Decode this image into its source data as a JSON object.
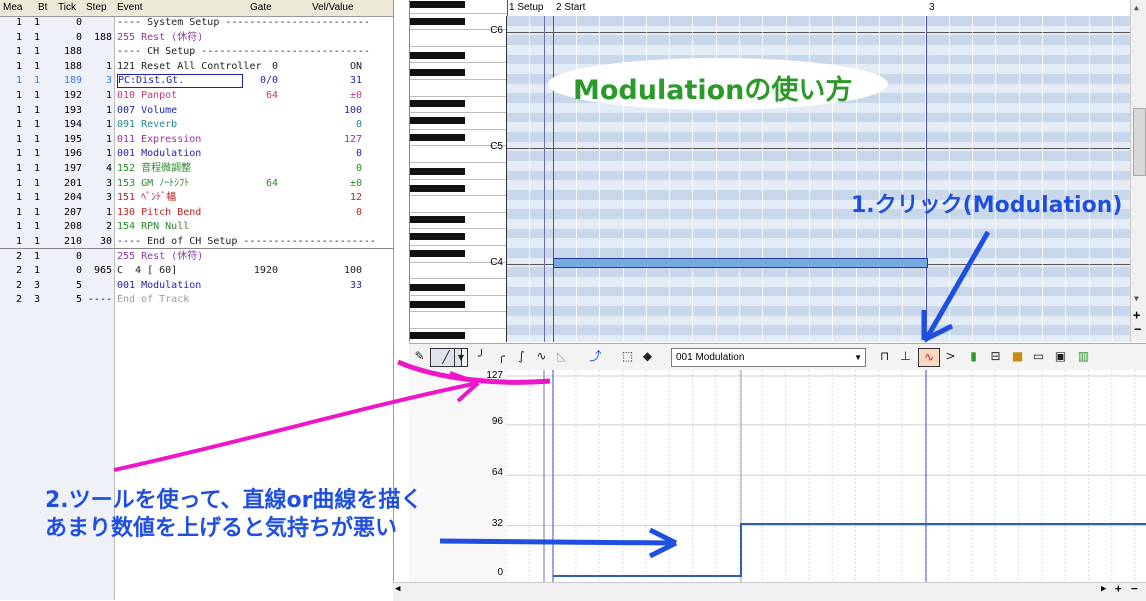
{
  "event_list": {
    "headers": {
      "mea": "Mea",
      "bt": "Bt",
      "tick": "Tick",
      "step": "Step",
      "event": "Event",
      "gate": "Gate",
      "vel": "Vel/Value"
    },
    "rows": [
      {
        "mea": "1",
        "bt": "1",
        "tick": "0",
        "step": "",
        "event": "---- System Setup ------------------------",
        "gate": "",
        "vel": "",
        "color": "#202020"
      },
      {
        "mea": "1",
        "bt": "1",
        "tick": "0",
        "step": "188",
        "event": "255 Rest (休符)",
        "gate": "",
        "vel": "",
        "color": "#8a3aa8"
      },
      {
        "mea": "1",
        "bt": "1",
        "tick": "188",
        "step": "",
        "event": "---- CH Setup ----------------------------",
        "gate": "",
        "vel": "",
        "color": "#202020"
      },
      {
        "mea": "1",
        "bt": "1",
        "tick": "188",
        "step": "1",
        "event": "121 Reset All Controller",
        "gate": "0",
        "vel": "ON",
        "color": "#202020"
      },
      {
        "mea": "1",
        "bt": "1",
        "tick": "189",
        "step": "3",
        "event": "PC:Dist.Gt.",
        "gate": "0/0",
        "vel": "31",
        "color": "#1f1fb0"
      },
      {
        "mea": "1",
        "bt": "1",
        "tick": "192",
        "step": "1",
        "event": "010 Panpot",
        "gate": "64",
        "vel": "±0",
        "color": "#c03a7a"
      },
      {
        "mea": "1",
        "bt": "1",
        "tick": "193",
        "step": "1",
        "event": "007 Volume",
        "gate": "",
        "vel": "100",
        "color": "#1f1fb0"
      },
      {
        "mea": "1",
        "bt": "1",
        "tick": "194",
        "step": "1",
        "event": "091 Reverb",
        "gate": "",
        "vel": "0",
        "color": "#1a8a8a"
      },
      {
        "mea": "1",
        "bt": "1",
        "tick": "195",
        "step": "1",
        "event": "011 Expression",
        "gate": "",
        "vel": "127",
        "color": "#a0309a"
      },
      {
        "mea": "1",
        "bt": "1",
        "tick": "196",
        "step": "1",
        "event": "001 Modulation",
        "gate": "",
        "vel": "0",
        "color": "#1f1fb0"
      },
      {
        "mea": "1",
        "bt": "1",
        "tick": "197",
        "step": "4",
        "event": "152 音程微調整",
        "gate": "",
        "vel": "0",
        "color": "#2a8a2a"
      },
      {
        "mea": "1",
        "bt": "1",
        "tick": "201",
        "step": "3",
        "event": "153 GM ﾉｰﾄｼﾌﾄ",
        "gate": "64",
        "vel": "±0",
        "color": "#2a8a2a"
      },
      {
        "mea": "1",
        "bt": "1",
        "tick": "204",
        "step": "3",
        "event": "151 ﾍﾞﾝﾄﾞ幅",
        "gate": "",
        "vel": "12",
        "color": "#c02020"
      },
      {
        "mea": "1",
        "bt": "1",
        "tick": "207",
        "step": "1",
        "event": "130 Pitch Bend",
        "gate": "",
        "vel": "0",
        "color": "#c02020"
      },
      {
        "mea": "1",
        "bt": "1",
        "tick": "208",
        "step": "2",
        "event": "154 RPN Null",
        "gate": "",
        "vel": "",
        "color": "#2a8a2a"
      },
      {
        "mea": "1",
        "bt": "1",
        "tick": "210",
        "step": "30",
        "event": "---- End of CH Setup ----------------------",
        "gate": "",
        "vel": "",
        "color": "#202020"
      },
      {
        "mea": "2",
        "bt": "1",
        "tick": "0",
        "step": "",
        "event": "255 Rest (休符)",
        "gate": "",
        "vel": "",
        "color": "#8a3aa8"
      },
      {
        "mea": "2",
        "bt": "1",
        "tick": "0",
        "step": "965",
        "event": "C  4 [ 60]",
        "gate": "1920",
        "vel": "100",
        "color": "#202020"
      },
      {
        "mea": "2",
        "bt": "3",
        "tick": "5",
        "step": "",
        "event": "001 Modulation",
        "gate": "",
        "vel": "33",
        "color": "#1f1fb0"
      },
      {
        "mea": "2",
        "bt": "3",
        "tick": "5",
        "step": "----",
        "event": "End of Track",
        "gate": "",
        "vel": "",
        "color": "#9a9a9a"
      }
    ]
  },
  "piano_roll": {
    "octave_labels": [
      "C6",
      "C5",
      "C4"
    ],
    "ruler_marks": [
      "1 Setup",
      "2 Start",
      "3"
    ]
  },
  "toolbar": {
    "controller_select": "001 Modulation",
    "icons": [
      "pencil-icon",
      "line-tool-icon",
      "dropdown-arrow-icon",
      "curve1-icon",
      "curve2-icon",
      "curve3-icon",
      "wave-icon",
      "gradient-icon",
      "connect-icon",
      "select-rect-icon",
      "eraser-icon",
      "bar-icon",
      "stamp-icon",
      "modulation-view-icon",
      "greater-icon",
      "meter-icon",
      "grid-icon",
      "lock-icon",
      "panel-icon",
      "wave-panel-icon",
      "level-icon"
    ]
  },
  "controller_graph": {
    "y_ticks": [
      "127",
      "96",
      "64",
      "32",
      "0"
    ],
    "modulation_values": [
      0,
      33
    ]
  },
  "annotations": {
    "title": "Modulationの使い方",
    "step1": "1.クリック(Modulation)",
    "step2_line1": "2.ツールを使って、直線or曲線を描く",
    "step2_line2": "あまり数値を上げると気持ちが悪い"
  },
  "colors": {
    "title_green": "#2b9a2b",
    "annotation_blue": "#1f4fe0",
    "arrow_magenta": "#ee16c8",
    "note_fill": "#78a8e0"
  }
}
